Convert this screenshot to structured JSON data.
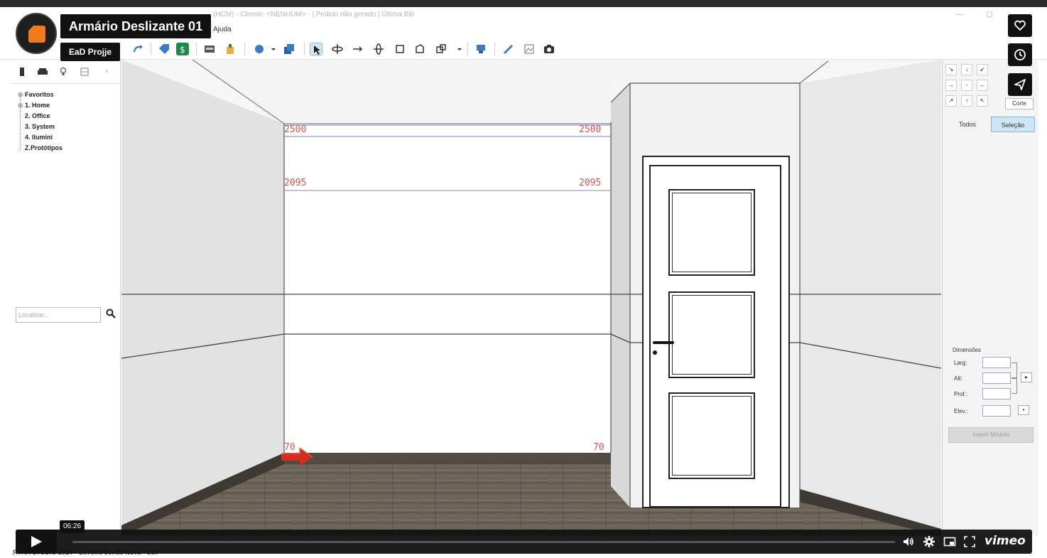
{
  "app": {
    "window_title": "(HCM) - Cliente: <NENHUM> - | Pedido não gerado | Última Bib",
    "menu_text": "Ajuda"
  },
  "video": {
    "title": "Armário Deslizante 01",
    "byline": "EaD Projje",
    "timestamp": "06:26",
    "brand": "vimeo"
  },
  "left_panel": {
    "tree": [
      {
        "label": "Favoritos",
        "expandable": true
      },
      {
        "label": "1. Home",
        "expandable": true
      },
      {
        "label": "2. Office",
        "expandable": false
      },
      {
        "label": "3. System",
        "expandable": false
      },
      {
        "label": "4. Ilumini",
        "expandable": false
      },
      {
        "label": "Z.Protótipos",
        "expandable": false
      }
    ],
    "search_placeholder": "Localizar..."
  },
  "viewport": {
    "dimension_labels": [
      "2500",
      "2500",
      "2095",
      "2095",
      "70",
      "70"
    ]
  },
  "right_panel": {
    "corte_label": "Corte",
    "tabs": [
      {
        "label": "Todos",
        "active": false
      },
      {
        "label": "Seleção",
        "active": true
      }
    ],
    "dimensions_title": "Dimensões",
    "fields": [
      {
        "label": "Larg:"
      },
      {
        "label": "Alt:"
      },
      {
        "label": "Prof.:"
      },
      {
        "label": "Elev.:"
      }
    ],
    "insert_button": "Inserir Módulo"
  },
  "status": {
    "left_text": "ЯTHR STUDIO 2024 - Cx Alvit Conde Nova - Ctrl"
  },
  "colors": {
    "accent_orange": "#f07b1d",
    "dimension_red": "#e05050",
    "selected_tab": "#cfe6f7"
  }
}
